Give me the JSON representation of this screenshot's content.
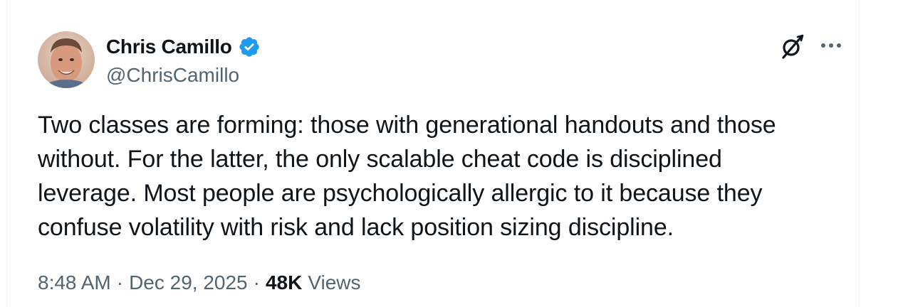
{
  "author": {
    "display_name": "Chris Camillo",
    "handle": "@ChrisCamillo",
    "verified": true,
    "verified_color": "#1d9bf0"
  },
  "tweet": {
    "text": "Two classes are forming: those with generational handouts and those\nwithout. For the latter, the only scalable cheat code is disciplined\nleverage. Most people are psychologically allergic to it because they\nconfuse volatility with risk and lack position sizing discipline."
  },
  "meta": {
    "time": "8:48 AM",
    "separator": "·",
    "date": "Dec 29, 2025",
    "views_count": "48K",
    "views_label": "Views"
  },
  "icons": {
    "verified": "verified-badge-icon",
    "grok": "grok-icon",
    "more": "more-options-icon"
  }
}
